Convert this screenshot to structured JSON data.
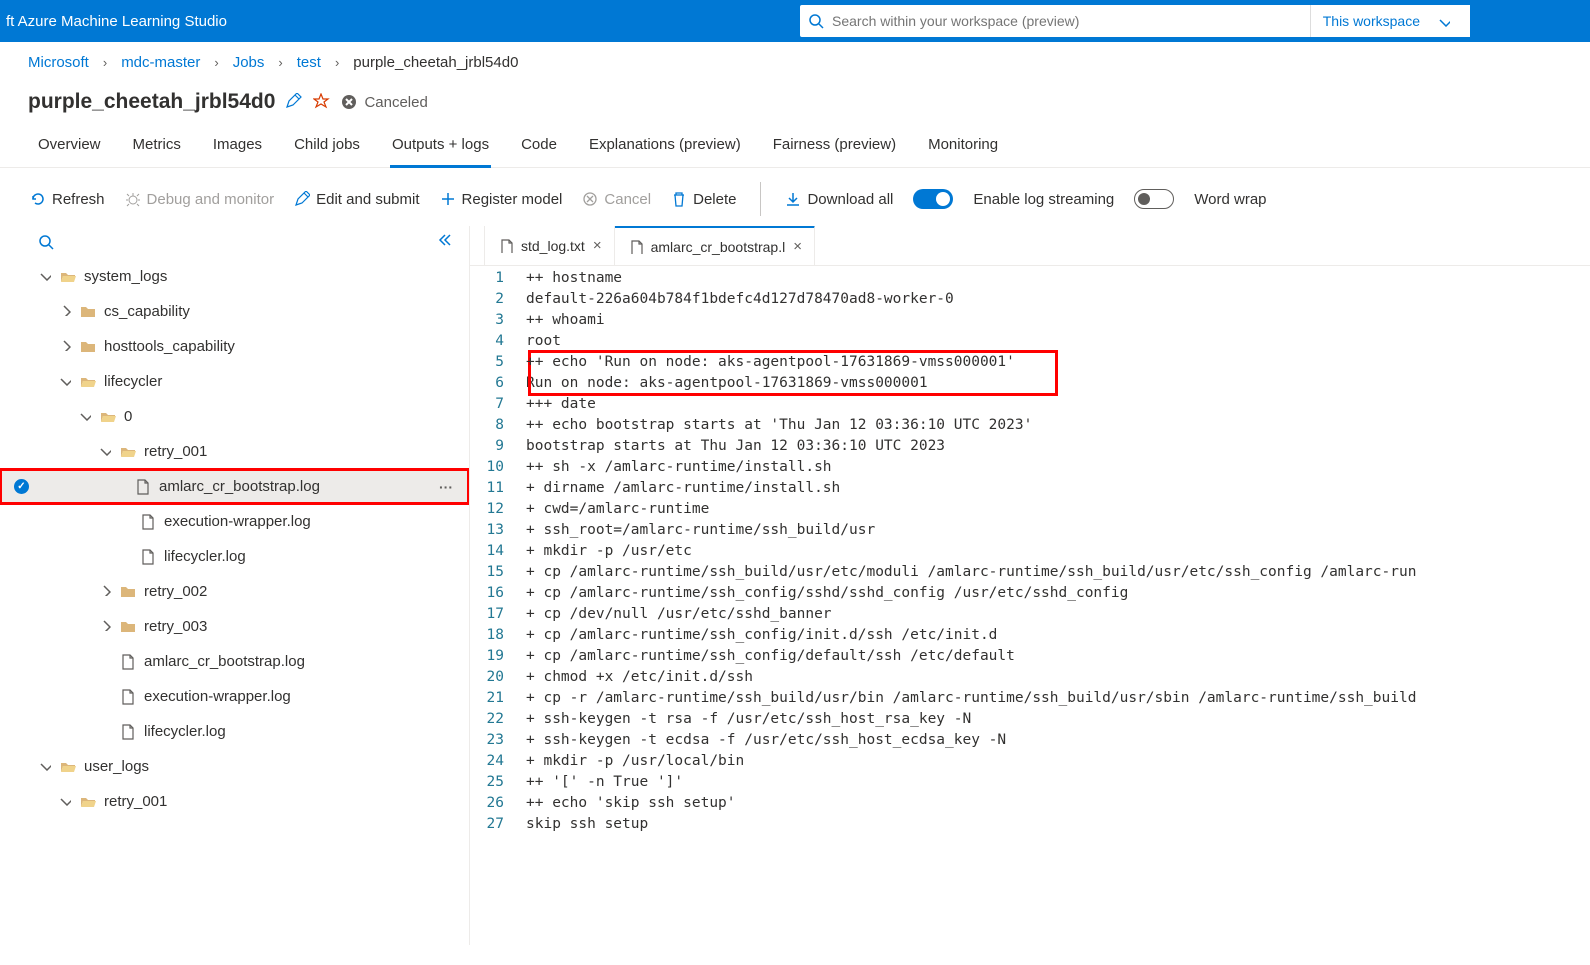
{
  "app_title": "ft Azure Machine Learning Studio",
  "search": {
    "placeholder": "Search within your workspace (preview)",
    "scope": "This workspace"
  },
  "breadcrumb": [
    {
      "label": "Microsoft",
      "link": true
    },
    {
      "label": "mdc-master",
      "link": true
    },
    {
      "label": "Jobs",
      "link": true
    },
    {
      "label": "test",
      "link": true
    },
    {
      "label": "purple_cheetah_jrbl54d0",
      "link": false
    }
  ],
  "job": {
    "name": "purple_cheetah_jrbl54d0",
    "status": "Canceled"
  },
  "tabs": [
    "Overview",
    "Metrics",
    "Images",
    "Child jobs",
    "Outputs + logs",
    "Code",
    "Explanations (preview)",
    "Fairness (preview)",
    "Monitoring"
  ],
  "active_tab": 4,
  "toolbar": {
    "refresh": "Refresh",
    "debug": "Debug and monitor",
    "edit": "Edit and submit",
    "register": "Register model",
    "cancel": "Cancel",
    "delete": "Delete",
    "download": "Download all",
    "stream": "Enable log streaming",
    "wrap": "Word wrap"
  },
  "tree": [
    {
      "depth": 0,
      "kind": "chev-down",
      "icon": "folder-open",
      "label": "system_logs"
    },
    {
      "depth": 1,
      "kind": "chev-right",
      "icon": "folder",
      "label": "cs_capability"
    },
    {
      "depth": 1,
      "kind": "chev-right",
      "icon": "folder",
      "label": "hosttools_capability"
    },
    {
      "depth": 1,
      "kind": "chev-down",
      "icon": "folder-open",
      "label": "lifecycler"
    },
    {
      "depth": 2,
      "kind": "chev-down",
      "icon": "folder-open",
      "label": "0"
    },
    {
      "depth": 3,
      "kind": "chev-down",
      "icon": "folder-open",
      "label": "retry_001"
    },
    {
      "depth": 4,
      "kind": "file",
      "icon": "file",
      "label": "amlarc_cr_bootstrap.log",
      "selected": true,
      "check": true,
      "more": true
    },
    {
      "depth": 4,
      "kind": "file",
      "icon": "file",
      "label": "execution-wrapper.log"
    },
    {
      "depth": 4,
      "kind": "file",
      "icon": "file",
      "label": "lifecycler.log"
    },
    {
      "depth": 3,
      "kind": "chev-right",
      "icon": "folder",
      "label": "retry_002"
    },
    {
      "depth": 3,
      "kind": "chev-right",
      "icon": "folder",
      "label": "retry_003"
    },
    {
      "depth": 3,
      "kind": "file",
      "icon": "file",
      "label": "amlarc_cr_bootstrap.log"
    },
    {
      "depth": 3,
      "kind": "file",
      "icon": "file",
      "label": "execution-wrapper.log"
    },
    {
      "depth": 3,
      "kind": "file",
      "icon": "file",
      "label": "lifecycler.log"
    },
    {
      "depth": 0,
      "kind": "chev-down",
      "icon": "folder-open",
      "label": "user_logs"
    },
    {
      "depth": 1,
      "kind": "chev-down",
      "icon": "folder-open",
      "label": "retry_001"
    }
  ],
  "editor_tabs": [
    {
      "name": "std_log.txt",
      "active": false
    },
    {
      "name": "amlarc_cr_bootstrap.l",
      "active": true
    }
  ],
  "code_lines": [
    "++ hostname",
    "default-226a604b784f1bdefc4d127d78470ad8-worker-0",
    "++ whoami",
    "root",
    "++ echo 'Run on node: aks-agentpool-17631869-vmss000001'",
    "Run on node: aks-agentpool-17631869-vmss000001",
    "+++ date",
    "++ echo bootstrap starts at 'Thu Jan 12 03:36:10 UTC 2023'",
    "bootstrap starts at Thu Jan 12 03:36:10 UTC 2023",
    "++ sh -x /amlarc-runtime/install.sh",
    "+ dirname /amlarc-runtime/install.sh",
    "+ cwd=/amlarc-runtime",
    "+ ssh_root=/amlarc-runtime/ssh_build/usr",
    "+ mkdir -p /usr/etc",
    "+ cp /amlarc-runtime/ssh_build/usr/etc/moduli /amlarc-runtime/ssh_build/usr/etc/ssh_config /amlarc-run",
    "+ cp /amlarc-runtime/ssh_config/sshd/sshd_config /usr/etc/sshd_config",
    "+ cp /dev/null /usr/etc/sshd_banner",
    "+ cp /amlarc-runtime/ssh_config/init.d/ssh /etc/init.d",
    "+ cp /amlarc-runtime/ssh_config/default/ssh /etc/default",
    "+ chmod +x /etc/init.d/ssh",
    "+ cp -r /amlarc-runtime/ssh_build/usr/bin /amlarc-runtime/ssh_build/usr/sbin /amlarc-runtime/ssh_build",
    "+ ssh-keygen -t rsa -f /usr/etc/ssh_host_rsa_key -N",
    "+ ssh-keygen -t ecdsa -f /usr/etc/ssh_host_ecdsa_key -N",
    "+ mkdir -p /usr/local/bin",
    "++ '[' -n True ']'",
    "++ echo 'skip ssh setup'",
    "skip ssh setup"
  ],
  "highlight_lines": [
    5,
    6
  ]
}
